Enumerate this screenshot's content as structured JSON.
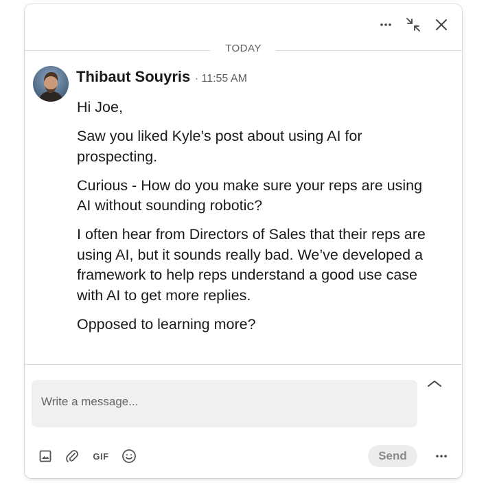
{
  "header": {
    "more_icon": "ellipsis-icon",
    "minimize_icon": "minimize-arrows-icon",
    "close_icon": "close-icon"
  },
  "conversation": {
    "date_divider": "TODAY",
    "sender": {
      "name": "Thibaut Souyris",
      "time": "· 11:55 AM"
    },
    "message_paragraphs": [
      "Hi Joe,",
      "Saw you liked Kyle’s post about using AI for prospecting.",
      "Curious - How do you make sure your reps are using AI without sounding robotic?",
      "I often hear from Directors of Sales that their reps are using AI, but it sounds really bad. We’ve developed a framework to help reps understand a good use case with AI to get more replies.",
      "Opposed to learning more?"
    ]
  },
  "composer": {
    "placeholder": "Write a message...",
    "value": "",
    "gif_label": "GIF",
    "send_label": "Send",
    "icons": [
      "image-icon",
      "paperclip-icon",
      "gif-icon",
      "emoji-icon",
      "ellipsis-icon",
      "chevron-up-icon"
    ]
  },
  "colors": {
    "text_primary": "#1a1a1a",
    "text_secondary": "#5e5e5e",
    "compose_bg": "#f2f0ee",
    "send_bg": "#ececec",
    "send_text": "#8a8a8a"
  }
}
